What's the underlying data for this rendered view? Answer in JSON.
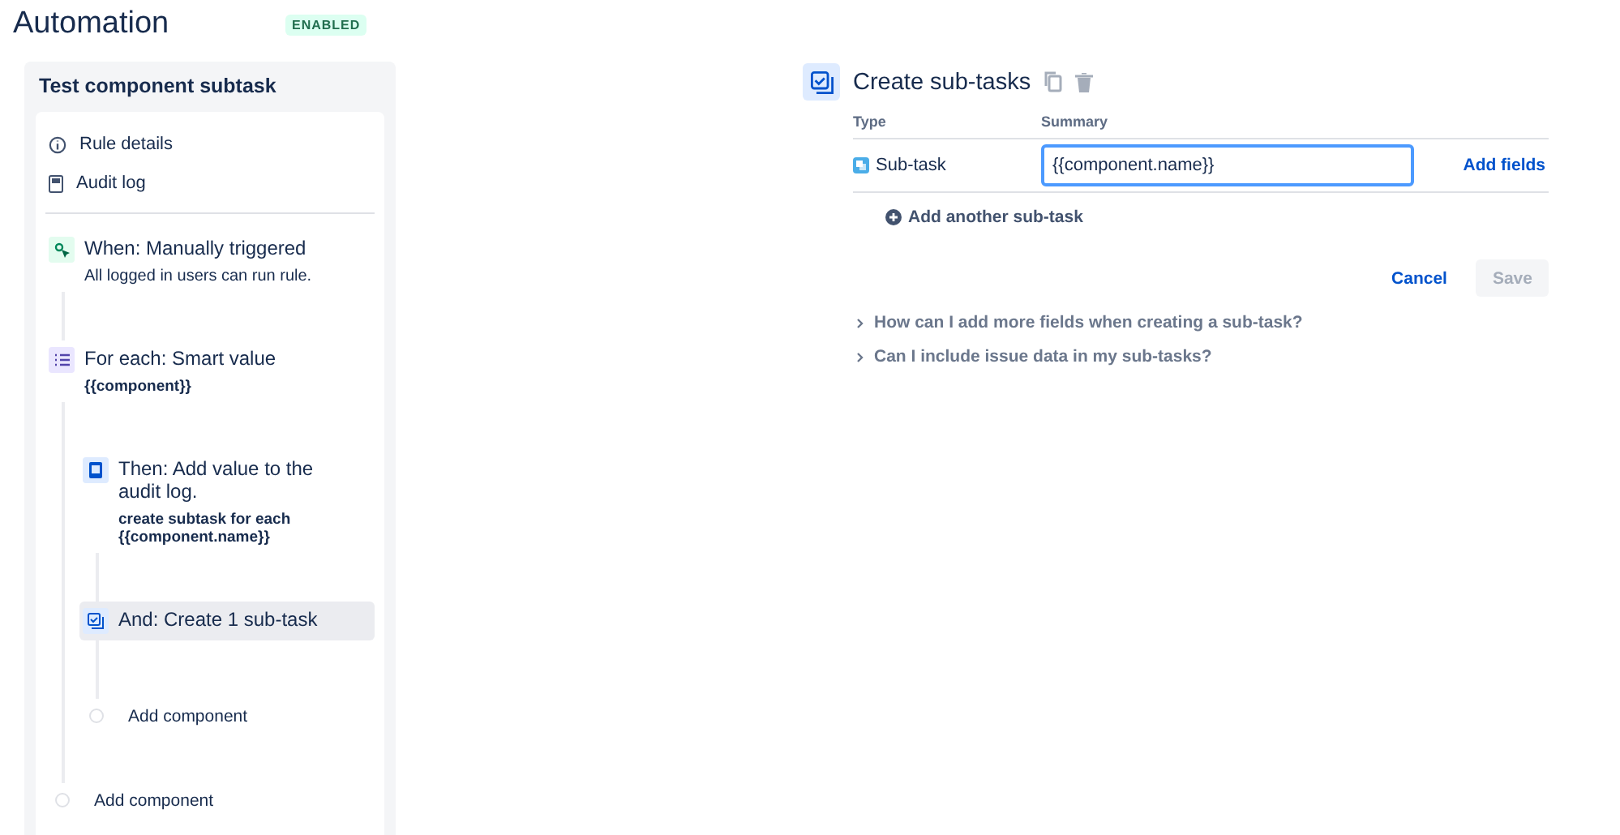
{
  "header": {
    "title": "Automation",
    "status": "ENABLED"
  },
  "rule": {
    "name": "Test component subtask",
    "links": [
      {
        "kind": "info",
        "label": "Rule details"
      },
      {
        "kind": "log",
        "label": "Audit log"
      }
    ],
    "components": [
      {
        "kind": "trigger",
        "title": "When: Manually triggered",
        "detail": "All logged in users can run rule.",
        "selected": false
      },
      {
        "kind": "branch",
        "title": "For each: Smart value",
        "detail": "{{component}}",
        "selected": false,
        "children": [
          {
            "kind": "log",
            "title": "Then: Add value to the audit log.",
            "detail": "create subtask for each {{component.name}}",
            "selected": false
          },
          {
            "kind": "subtask",
            "title": "And: Create 1 sub-task",
            "selected": true
          },
          {
            "kind": "add",
            "title": "Add component",
            "selected": false
          }
        ]
      },
      {
        "kind": "add",
        "title": "Add component",
        "selected": false
      }
    ]
  },
  "editor": {
    "title": "Create sub-tasks",
    "columns": [
      "Type",
      "Summary"
    ],
    "rows": [
      {
        "type": "Sub-task",
        "summary": "{{component.name}}",
        "action": "Add fields"
      }
    ],
    "add_label": "Add another sub-task",
    "buttons": [
      {
        "kind": "link",
        "label": "Cancel",
        "disabled": false
      },
      {
        "kind": "primary",
        "label": "Save",
        "disabled": true
      }
    ],
    "faqs": [
      {
        "label": "How can I add more fields when creating a sub-task?",
        "expanded": false
      },
      {
        "label": "Can I include issue data in my sub-tasks?",
        "expanded": false
      }
    ]
  }
}
